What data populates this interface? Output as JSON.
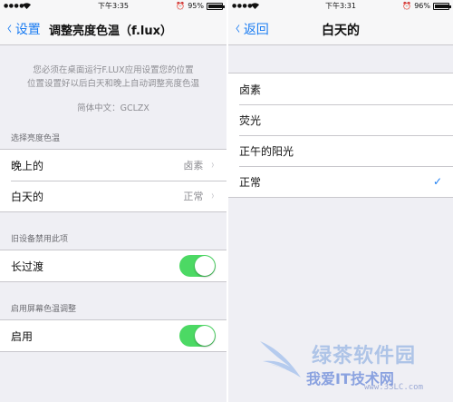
{
  "left_screen": {
    "statusbar": {
      "signal": "●●●●●",
      "time": "下午3:35",
      "battery_percent": "95%",
      "battery_level": 0.95
    },
    "navbar": {
      "back_label": "设置",
      "title": "调整亮度色温（f.lux）"
    },
    "info": {
      "line1": "您必须在桌面运行F.LUX应用设置您的位置",
      "line2": "位置设置好以后白天和晚上自动调整亮度色温",
      "credit": "简体中文：GCLZX"
    },
    "section_brightness": {
      "header": "选择亮度色温",
      "rows": [
        {
          "label": "晚上的",
          "value": "卤素"
        },
        {
          "label": "白天的",
          "value": "正常"
        }
      ]
    },
    "section_legacy": {
      "header": "旧设备禁用此项",
      "row_label": "长过渡",
      "toggle_on": true
    },
    "section_screen": {
      "header": "启用屏幕色温调整",
      "row_label": "启用",
      "toggle_on": true
    }
  },
  "right_screen": {
    "statusbar": {
      "signal": "●●●●●",
      "time": "下午3:31",
      "battery_percent": "96%",
      "battery_level": 0.96
    },
    "navbar": {
      "back_label": "返回",
      "title": "白天的"
    },
    "options": [
      "卤素",
      "荧光",
      "正午的阳光",
      "正常"
    ],
    "selected_index": 3,
    "checkmark": "✓"
  },
  "watermark": {
    "text1": "绿茶软件园",
    "text2": "我爱IT技术网",
    "url": "www.33LC.com"
  },
  "colors": {
    "accent": "#1a7cf2",
    "toggle_on": "#4cd964",
    "background": "#efeff4"
  }
}
